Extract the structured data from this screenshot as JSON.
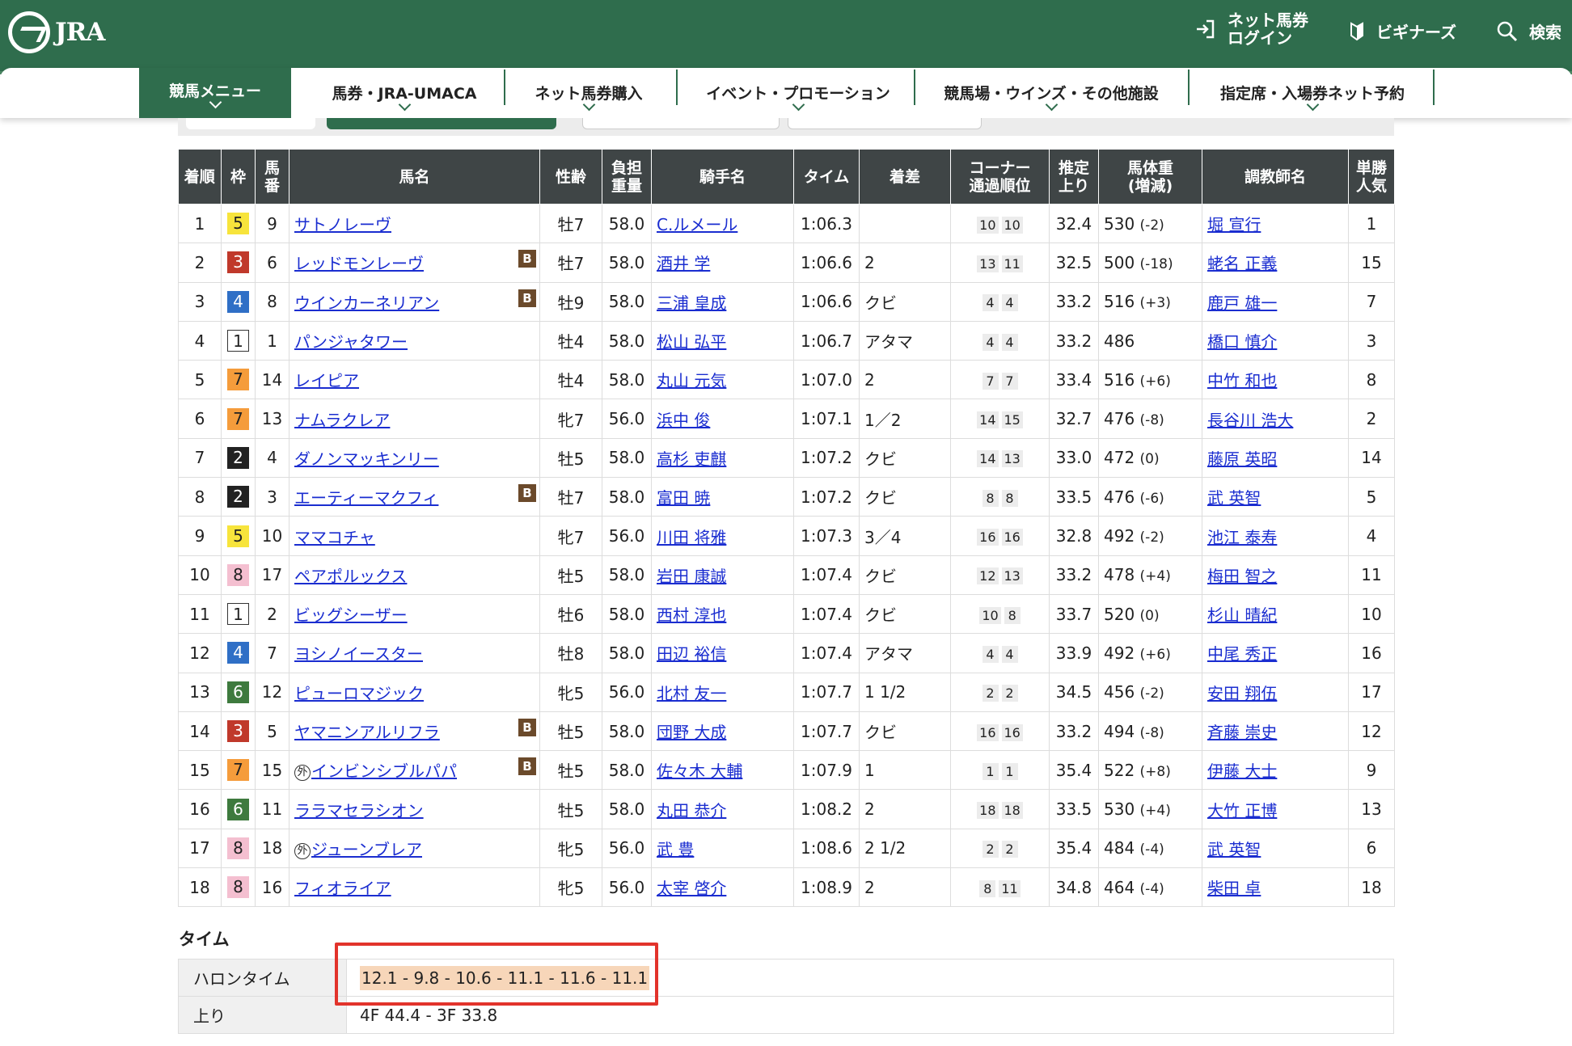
{
  "header": {
    "logo_text": "JRA",
    "login_label": "ネット馬券\nログイン",
    "beginner_label": "ビギナーズ",
    "search_label": "検索"
  },
  "nav": {
    "items": [
      "競馬メニュー",
      "馬券・JRA-UMACA",
      "ネット馬券購入",
      "イベント・プロモーション",
      "競馬場・ウインズ・その他施設",
      "指定席・入場券ネット予約"
    ]
  },
  "table": {
    "headers": [
      "着順",
      "枠",
      "馬番",
      "馬名",
      "性齢",
      "負担重量",
      "騎手名",
      "タイム",
      "着差",
      "コーナー通過順位",
      "推定上り",
      "馬体重(増減)",
      "調教師名",
      "単勝人気"
    ],
    "rows": [
      {
        "rank": "1",
        "waku": "5",
        "num": "9",
        "name": "サトノレーヴ",
        "b": "",
        "gai": "",
        "sex": "牡7",
        "wgt": "58.0",
        "jockey": "C.ルメール",
        "time": "1:06.3",
        "margin": "",
        "c1": "10",
        "c2": "10",
        "last": "32.4",
        "bw": "530",
        "bwd": "(-2)",
        "trainer": "堀 宣行",
        "pop": "1"
      },
      {
        "rank": "2",
        "waku": "3",
        "num": "6",
        "name": "レッドモンレーヴ",
        "b": "B",
        "gai": "",
        "sex": "牡7",
        "wgt": "58.0",
        "jockey": "酒井 学",
        "time": "1:06.6",
        "margin": "2",
        "c1": "13",
        "c2": "11",
        "last": "32.5",
        "bw": "500",
        "bwd": "(-18)",
        "trainer": "蛯名 正義",
        "pop": "15"
      },
      {
        "rank": "3",
        "waku": "4",
        "num": "8",
        "name": "ウインカーネリアン",
        "b": "B",
        "gai": "",
        "sex": "牡9",
        "wgt": "58.0",
        "jockey": "三浦 皇成",
        "time": "1:06.6",
        "margin": "クビ",
        "c1": "4",
        "c2": "4",
        "last": "33.2",
        "bw": "516",
        "bwd": "(+3)",
        "trainer": "鹿戸 雄一",
        "pop": "7"
      },
      {
        "rank": "4",
        "waku": "1",
        "num": "1",
        "name": "パンジャタワー",
        "b": "",
        "gai": "",
        "sex": "牡4",
        "wgt": "58.0",
        "jockey": "松山 弘平",
        "time": "1:06.7",
        "margin": "アタマ",
        "c1": "4",
        "c2": "4",
        "last": "33.2",
        "bw": "486",
        "bwd": "",
        "trainer": "橋口 慎介",
        "pop": "3"
      },
      {
        "rank": "5",
        "waku": "7",
        "num": "14",
        "name": "レイピア",
        "b": "",
        "gai": "",
        "sex": "牡4",
        "wgt": "58.0",
        "jockey": "丸山 元気",
        "time": "1:07.0",
        "margin": "2",
        "c1": "7",
        "c2": "7",
        "last": "33.4",
        "bw": "516",
        "bwd": "(+6)",
        "trainer": "中竹 和也",
        "pop": "8"
      },
      {
        "rank": "6",
        "waku": "7",
        "num": "13",
        "name": "ナムラクレア",
        "b": "",
        "gai": "",
        "sex": "牝7",
        "wgt": "56.0",
        "jockey": "浜中 俊",
        "time": "1:07.1",
        "margin": "1／2",
        "c1": "14",
        "c2": "15",
        "last": "32.7",
        "bw": "476",
        "bwd": "(-8)",
        "trainer": "長谷川 浩大",
        "pop": "2"
      },
      {
        "rank": "7",
        "waku": "2",
        "num": "4",
        "name": "ダノンマッキンリー",
        "b": "",
        "gai": "",
        "sex": "牡5",
        "wgt": "58.0",
        "jockey": "高杉 吏麒",
        "time": "1:07.2",
        "margin": "クビ",
        "c1": "14",
        "c2": "13",
        "last": "33.0",
        "bw": "472",
        "bwd": "(0)",
        "trainer": "藤原 英昭",
        "pop": "14"
      },
      {
        "rank": "8",
        "waku": "2",
        "num": "3",
        "name": "エーティーマクフィ",
        "b": "B",
        "gai": "",
        "sex": "牡7",
        "wgt": "58.0",
        "jockey": "富田 暁",
        "time": "1:07.2",
        "margin": "クビ",
        "c1": "8",
        "c2": "8",
        "last": "33.5",
        "bw": "476",
        "bwd": "(-6)",
        "trainer": "武 英智",
        "pop": "5"
      },
      {
        "rank": "9",
        "waku": "5",
        "num": "10",
        "name": "ママコチャ",
        "b": "",
        "gai": "",
        "sex": "牝7",
        "wgt": "56.0",
        "jockey": "川田 将雅",
        "time": "1:07.3",
        "margin": "3／4",
        "c1": "16",
        "c2": "16",
        "last": "32.8",
        "bw": "492",
        "bwd": "(-2)",
        "trainer": "池江 泰寿",
        "pop": "4"
      },
      {
        "rank": "10",
        "waku": "8",
        "num": "17",
        "name": "ペアポルックス",
        "b": "",
        "gai": "",
        "sex": "牡5",
        "wgt": "58.0",
        "jockey": "岩田 康誠",
        "time": "1:07.4",
        "margin": "クビ",
        "c1": "12",
        "c2": "13",
        "last": "33.2",
        "bw": "478",
        "bwd": "(+4)",
        "trainer": "梅田 智之",
        "pop": "11"
      },
      {
        "rank": "11",
        "waku": "1",
        "num": "2",
        "name": "ビッグシーザー",
        "b": "",
        "gai": "",
        "sex": "牡6",
        "wgt": "58.0",
        "jockey": "西村 淳也",
        "time": "1:07.4",
        "margin": "クビ",
        "c1": "10",
        "c2": "8",
        "last": "33.7",
        "bw": "520",
        "bwd": "(0)",
        "trainer": "杉山 晴紀",
        "pop": "10"
      },
      {
        "rank": "12",
        "waku": "4",
        "num": "7",
        "name": "ヨシノイースター",
        "b": "",
        "gai": "",
        "sex": "牡8",
        "wgt": "58.0",
        "jockey": "田辺 裕信",
        "time": "1:07.4",
        "margin": "アタマ",
        "c1": "4",
        "c2": "4",
        "last": "33.9",
        "bw": "492",
        "bwd": "(+6)",
        "trainer": "中尾 秀正",
        "pop": "16"
      },
      {
        "rank": "13",
        "waku": "6",
        "num": "12",
        "name": "ピューロマジック",
        "b": "",
        "gai": "",
        "sex": "牝5",
        "wgt": "56.0",
        "jockey": "北村 友一",
        "time": "1:07.7",
        "margin": "1 1/2",
        "c1": "2",
        "c2": "2",
        "last": "34.5",
        "bw": "456",
        "bwd": "(-2)",
        "trainer": "安田 翔伍",
        "pop": "17"
      },
      {
        "rank": "14",
        "waku": "3",
        "num": "5",
        "name": "ヤマニンアルリフラ",
        "b": "B",
        "gai": "",
        "sex": "牡5",
        "wgt": "58.0",
        "jockey": "団野 大成",
        "time": "1:07.7",
        "margin": "クビ",
        "c1": "16",
        "c2": "16",
        "last": "33.2",
        "bw": "494",
        "bwd": "(-8)",
        "trainer": "斉藤 崇史",
        "pop": "12"
      },
      {
        "rank": "15",
        "waku": "7",
        "num": "15",
        "name": "インビンシブルパパ",
        "b": "B",
        "gai": "外",
        "sex": "牡5",
        "wgt": "58.0",
        "jockey": "佐々木 大輔",
        "time": "1:07.9",
        "margin": "1",
        "c1": "1",
        "c2": "1",
        "last": "35.4",
        "bw": "522",
        "bwd": "(+8)",
        "trainer": "伊藤 大士",
        "pop": "9"
      },
      {
        "rank": "16",
        "waku": "6",
        "num": "11",
        "name": "ララマセラシオン",
        "b": "",
        "gai": "",
        "sex": "牡5",
        "wgt": "58.0",
        "jockey": "丸田 恭介",
        "time": "1:08.2",
        "margin": "2",
        "c1": "18",
        "c2": "18",
        "last": "33.5",
        "bw": "530",
        "bwd": "(+4)",
        "trainer": "大竹 正博",
        "pop": "13"
      },
      {
        "rank": "17",
        "waku": "8",
        "num": "18",
        "name": "ジューンブレア",
        "b": "",
        "gai": "外",
        "sex": "牝5",
        "wgt": "56.0",
        "jockey": "武 豊",
        "time": "1:08.6",
        "margin": "2 1/2",
        "c1": "2",
        "c2": "2",
        "last": "35.4",
        "bw": "484",
        "bwd": "(-4)",
        "trainer": "武 英智",
        "pop": "6"
      },
      {
        "rank": "18",
        "waku": "8",
        "num": "16",
        "name": "フィオライア",
        "b": "",
        "gai": "",
        "sex": "牝5",
        "wgt": "56.0",
        "jockey": "太宰 啓介",
        "time": "1:08.9",
        "margin": "2",
        "c1": "8",
        "c2": "11",
        "last": "34.8",
        "bw": "464",
        "bwd": "(-4)",
        "trainer": "柴田 卓",
        "pop": "18"
      }
    ]
  },
  "time_section": {
    "title": "タイム",
    "furlong_label": "ハロンタイム",
    "furlong_value": "12.1 - 9.8 - 10.6 - 11.1 - 11.6 - 11.1",
    "agari_label": "上り",
    "agari_value": "4F 44.4 - 3F 33.8"
  },
  "colors": {
    "header_green": "#2f6d4d",
    "highlight": "#e2332b",
    "link": "#1a2dd0"
  }
}
